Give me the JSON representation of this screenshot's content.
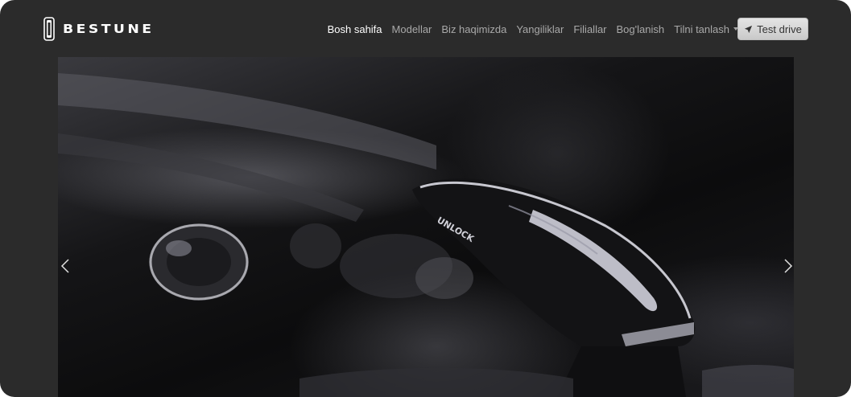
{
  "brand": {
    "name": "BESTUNE",
    "emblem_icon": "bestune-emblem-icon"
  },
  "nav": {
    "items": [
      {
        "label": "Bosh sahifa",
        "active": true
      },
      {
        "label": "Modellar",
        "active": false
      },
      {
        "label": "Biz haqimizda",
        "active": false
      },
      {
        "label": "Yangiliklar",
        "active": false
      },
      {
        "label": "Filiallar",
        "active": false
      },
      {
        "label": "Bog'lanish",
        "active": false
      }
    ],
    "language_label": "Tilni tanlash"
  },
  "cta": {
    "label": "Test drive",
    "icon": "send-arrow-icon"
  },
  "carousel": {
    "slide_text": "UNLOCK",
    "prev_icon": "chevron-left-icon",
    "next_icon": "chevron-right-icon"
  },
  "colors": {
    "window_bg": "#2b2b2b",
    "nav_text": "#a9a9a9",
    "nav_active": "#ffffff",
    "button_bg": "#d6d6d6"
  }
}
